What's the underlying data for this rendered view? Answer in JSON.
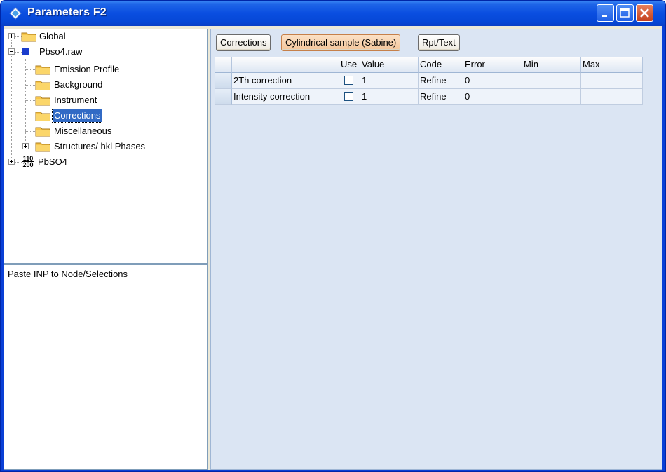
{
  "window": {
    "title": "Parameters F2",
    "colors": {
      "title_bar": "#0a4ee0",
      "content_bg": "#dbe5f3",
      "active_tab": "#f4c59a",
      "selection": "#316ac5"
    }
  },
  "tree": {
    "items": [
      {
        "label": "Global",
        "icon": "folder-icon",
        "expander": "plus"
      },
      {
        "label": "Pbso4.raw",
        "icon": "blue-square-icon",
        "expander": "minus"
      },
      {
        "label": "Emission Profile",
        "icon": "folder-icon"
      },
      {
        "label": "Background",
        "icon": "folder-icon"
      },
      {
        "label": "Instrument",
        "icon": "folder-icon"
      },
      {
        "label": "Corrections",
        "icon": "folder-icon",
        "selected": true
      },
      {
        "label": "Miscellaneous",
        "icon": "folder-icon"
      },
      {
        "label": "Structures/ hkl Phases",
        "icon": "folder-icon",
        "expander": "plus"
      },
      {
        "label": "PbSO4",
        "icon": "hkl-icon",
        "expander": "plus",
        "icon_text_top": "110",
        "icon_text_bottom": "200"
      }
    ]
  },
  "paste_panel": {
    "label": "Paste INP to Node/Selections"
  },
  "tabs": [
    {
      "label": "Corrections",
      "active": false
    },
    {
      "label": "Cylindrical sample (Sabine)",
      "active": true
    },
    {
      "label": "Rpt/Text",
      "active": false
    }
  ],
  "grid": {
    "columns": [
      "",
      "Use",
      "Value",
      "Code",
      "Error",
      "Min",
      "Max"
    ],
    "rows": [
      {
        "name": "2Th correction",
        "use": false,
        "value": "1",
        "code": "Refine",
        "error": "0",
        "min": "",
        "max": ""
      },
      {
        "name": "Intensity correction",
        "use": false,
        "value": "1",
        "code": "Refine",
        "error": "0",
        "min": "",
        "max": ""
      }
    ]
  }
}
